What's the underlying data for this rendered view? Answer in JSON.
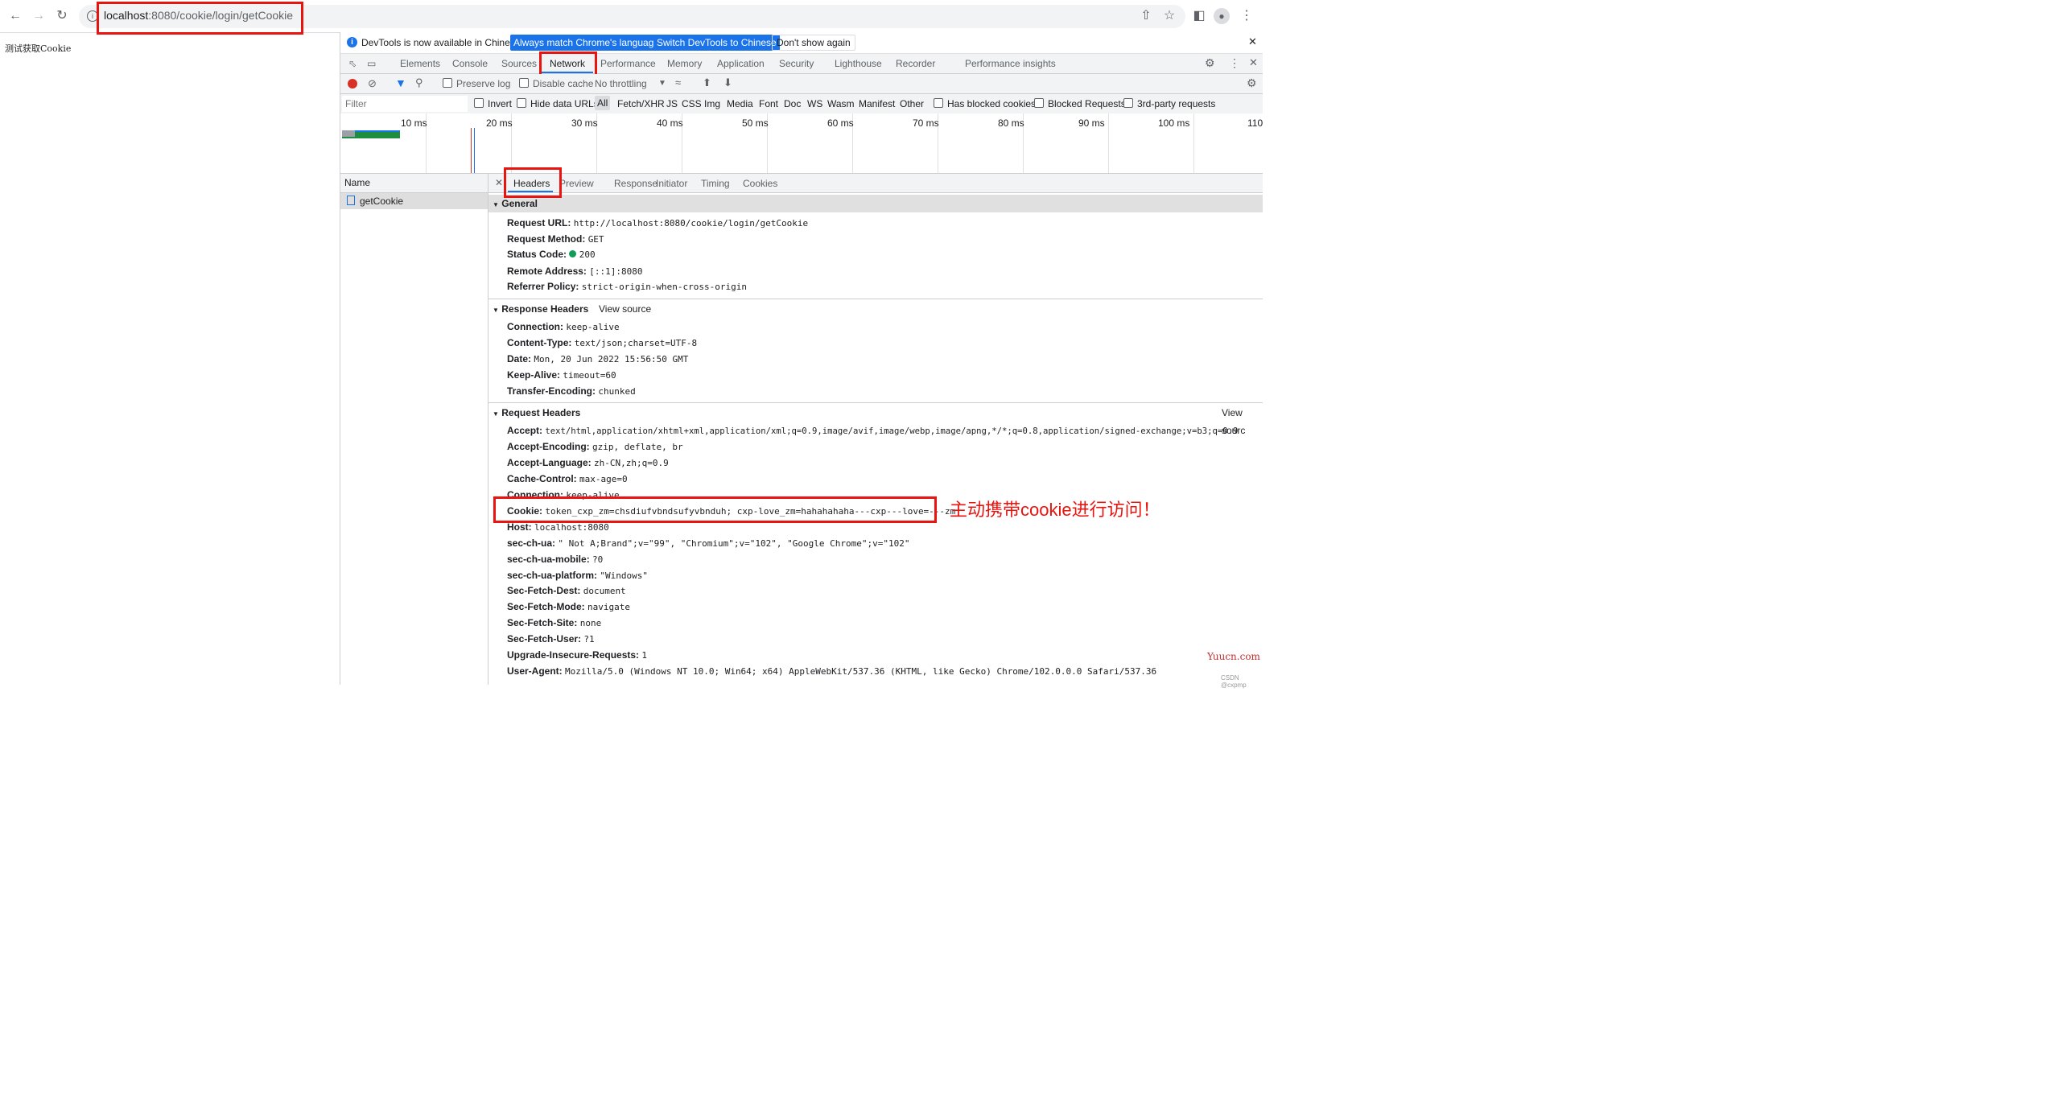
{
  "browser": {
    "url_host": "localhost",
    "url_rest": ":8080/cookie/login/getCookie"
  },
  "page": {
    "body_text": "测试获取Cookie"
  },
  "devtools": {
    "infobar": {
      "message": "DevTools is now available in Chinese!",
      "btn_match": "Always match Chrome's language",
      "btn_switch": "Switch DevTools to Chinese",
      "btn_dismiss": "Don't show again"
    },
    "tabs": [
      "Elements",
      "Console",
      "Sources",
      "Network",
      "Performance",
      "Memory",
      "Application",
      "Security",
      "Lighthouse",
      "Recorder",
      "Performance insights"
    ],
    "active_tab": "Network",
    "toolbar": {
      "preserve_log": "Preserve log",
      "disable_cache": "Disable cache",
      "throttling": "No throttling"
    },
    "filter": {
      "placeholder": "Filter",
      "invert": "Invert",
      "hide_data_urls": "Hide data URLs",
      "types": [
        "All",
        "Fetch/XHR",
        "JS",
        "CSS",
        "Img",
        "Media",
        "Font",
        "Doc",
        "WS",
        "Wasm",
        "Manifest",
        "Other"
      ],
      "has_blocked": "Has blocked cookies",
      "blocked_requests": "Blocked Requests",
      "third_party": "3rd-party requests"
    },
    "timeline_ticks": [
      "10 ms",
      "20 ms",
      "30 ms",
      "40 ms",
      "50 ms",
      "60 ms",
      "70 ms",
      "80 ms",
      "90 ms",
      "100 ms",
      "110"
    ],
    "name_column": "Name",
    "request_name": "getCookie",
    "detail_tabs": [
      "Headers",
      "Preview",
      "Response",
      "Initiator",
      "Timing",
      "Cookies"
    ],
    "general": {
      "title": "General",
      "rows": [
        {
          "k": "Request URL:",
          "v": "http://localhost:8080/cookie/login/getCookie"
        },
        {
          "k": "Request Method:",
          "v": "GET"
        },
        {
          "k": "Status Code:",
          "v": "200"
        },
        {
          "k": "Remote Address:",
          "v": "[::1]:8080"
        },
        {
          "k": "Referrer Policy:",
          "v": "strict-origin-when-cross-origin"
        }
      ]
    },
    "response_headers": {
      "title": "Response Headers",
      "view_source": "View source",
      "rows": [
        {
          "k": "Connection:",
          "v": "keep-alive"
        },
        {
          "k": "Content-Type:",
          "v": "text/json;charset=UTF-8"
        },
        {
          "k": "Date:",
          "v": "Mon, 20 Jun 2022 15:56:50 GMT"
        },
        {
          "k": "Keep-Alive:",
          "v": "timeout=60"
        },
        {
          "k": "Transfer-Encoding:",
          "v": "chunked"
        }
      ]
    },
    "request_headers": {
      "title": "Request Headers",
      "view_source": "View sourc",
      "rows": [
        {
          "k": "Accept:",
          "v": "text/html,application/xhtml+xml,application/xml;q=0.9,image/avif,image/webp,image/apng,*/*;q=0.8,application/signed-exchange;v=b3;q=0.9"
        },
        {
          "k": "Accept-Encoding:",
          "v": "gzip, deflate, br"
        },
        {
          "k": "Accept-Language:",
          "v": "zh-CN,zh;q=0.9"
        },
        {
          "k": "Cache-Control:",
          "v": "max-age=0"
        },
        {
          "k": "Connection:",
          "v": "keep-alive"
        },
        {
          "k": "Cookie:",
          "v": "token_cxp_zm=chsdiufvbndsufyvbnduh; cxp-love_zm=hahahahaha---cxp---love=---zm"
        },
        {
          "k": "Host:",
          "v": "localhost:8080"
        },
        {
          "k": "sec-ch-ua:",
          "v": "\" Not A;Brand\";v=\"99\", \"Chromium\";v=\"102\", \"Google Chrome\";v=\"102\""
        },
        {
          "k": "sec-ch-ua-mobile:",
          "v": "?0"
        },
        {
          "k": "sec-ch-ua-platform:",
          "v": "\"Windows\""
        },
        {
          "k": "Sec-Fetch-Dest:",
          "v": "document"
        },
        {
          "k": "Sec-Fetch-Mode:",
          "v": "navigate"
        },
        {
          "k": "Sec-Fetch-Site:",
          "v": "none"
        },
        {
          "k": "Sec-Fetch-User:",
          "v": "?1"
        },
        {
          "k": "Upgrade-Insecure-Requests:",
          "v": "1"
        },
        {
          "k": "User-Agent:",
          "v": "Mozilla/5.0 (Windows NT 10.0; Win64; x64) AppleWebKit/537.36 (KHTML, like Gecko) Chrome/102.0.0.0 Safari/537.36"
        }
      ]
    }
  },
  "annotation": "主动携带cookie进行访问！",
  "watermark": "Yuucn.com",
  "csdn": "CSDN @cxpmp",
  "colors": {
    "annotation_red": "#e8140f",
    "accent_blue": "#1a73e8",
    "status_green": "#0f9d58"
  }
}
